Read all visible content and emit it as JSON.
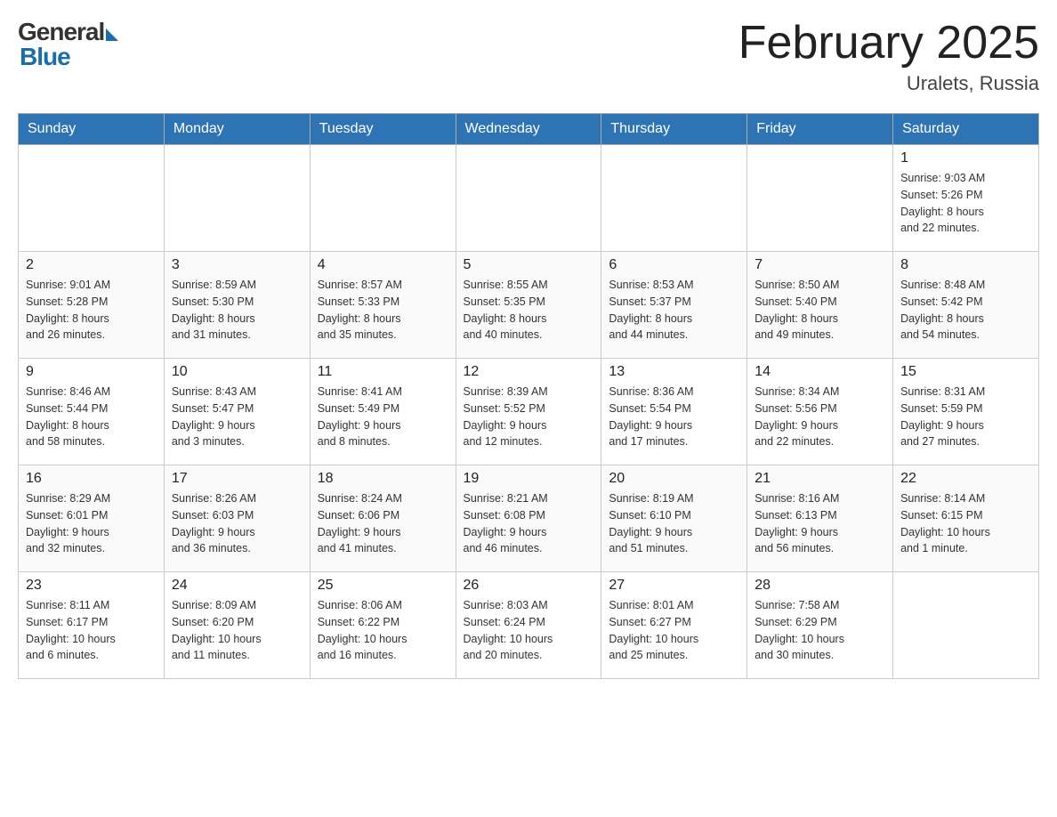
{
  "header": {
    "logo_general": "General",
    "logo_blue": "Blue",
    "month_title": "February 2025",
    "location": "Uralets, Russia"
  },
  "days_of_week": [
    "Sunday",
    "Monday",
    "Tuesday",
    "Wednesday",
    "Thursday",
    "Friday",
    "Saturday"
  ],
  "weeks": [
    [
      {
        "day": "",
        "info": ""
      },
      {
        "day": "",
        "info": ""
      },
      {
        "day": "",
        "info": ""
      },
      {
        "day": "",
        "info": ""
      },
      {
        "day": "",
        "info": ""
      },
      {
        "day": "",
        "info": ""
      },
      {
        "day": "1",
        "info": "Sunrise: 9:03 AM\nSunset: 5:26 PM\nDaylight: 8 hours\nand 22 minutes."
      }
    ],
    [
      {
        "day": "2",
        "info": "Sunrise: 9:01 AM\nSunset: 5:28 PM\nDaylight: 8 hours\nand 26 minutes."
      },
      {
        "day": "3",
        "info": "Sunrise: 8:59 AM\nSunset: 5:30 PM\nDaylight: 8 hours\nand 31 minutes."
      },
      {
        "day": "4",
        "info": "Sunrise: 8:57 AM\nSunset: 5:33 PM\nDaylight: 8 hours\nand 35 minutes."
      },
      {
        "day": "5",
        "info": "Sunrise: 8:55 AM\nSunset: 5:35 PM\nDaylight: 8 hours\nand 40 minutes."
      },
      {
        "day": "6",
        "info": "Sunrise: 8:53 AM\nSunset: 5:37 PM\nDaylight: 8 hours\nand 44 minutes."
      },
      {
        "day": "7",
        "info": "Sunrise: 8:50 AM\nSunset: 5:40 PM\nDaylight: 8 hours\nand 49 minutes."
      },
      {
        "day": "8",
        "info": "Sunrise: 8:48 AM\nSunset: 5:42 PM\nDaylight: 8 hours\nand 54 minutes."
      }
    ],
    [
      {
        "day": "9",
        "info": "Sunrise: 8:46 AM\nSunset: 5:44 PM\nDaylight: 8 hours\nand 58 minutes."
      },
      {
        "day": "10",
        "info": "Sunrise: 8:43 AM\nSunset: 5:47 PM\nDaylight: 9 hours\nand 3 minutes."
      },
      {
        "day": "11",
        "info": "Sunrise: 8:41 AM\nSunset: 5:49 PM\nDaylight: 9 hours\nand 8 minutes."
      },
      {
        "day": "12",
        "info": "Sunrise: 8:39 AM\nSunset: 5:52 PM\nDaylight: 9 hours\nand 12 minutes."
      },
      {
        "day": "13",
        "info": "Sunrise: 8:36 AM\nSunset: 5:54 PM\nDaylight: 9 hours\nand 17 minutes."
      },
      {
        "day": "14",
        "info": "Sunrise: 8:34 AM\nSunset: 5:56 PM\nDaylight: 9 hours\nand 22 minutes."
      },
      {
        "day": "15",
        "info": "Sunrise: 8:31 AM\nSunset: 5:59 PM\nDaylight: 9 hours\nand 27 minutes."
      }
    ],
    [
      {
        "day": "16",
        "info": "Sunrise: 8:29 AM\nSunset: 6:01 PM\nDaylight: 9 hours\nand 32 minutes."
      },
      {
        "day": "17",
        "info": "Sunrise: 8:26 AM\nSunset: 6:03 PM\nDaylight: 9 hours\nand 36 minutes."
      },
      {
        "day": "18",
        "info": "Sunrise: 8:24 AM\nSunset: 6:06 PM\nDaylight: 9 hours\nand 41 minutes."
      },
      {
        "day": "19",
        "info": "Sunrise: 8:21 AM\nSunset: 6:08 PM\nDaylight: 9 hours\nand 46 minutes."
      },
      {
        "day": "20",
        "info": "Sunrise: 8:19 AM\nSunset: 6:10 PM\nDaylight: 9 hours\nand 51 minutes."
      },
      {
        "day": "21",
        "info": "Sunrise: 8:16 AM\nSunset: 6:13 PM\nDaylight: 9 hours\nand 56 minutes."
      },
      {
        "day": "22",
        "info": "Sunrise: 8:14 AM\nSunset: 6:15 PM\nDaylight: 10 hours\nand 1 minute."
      }
    ],
    [
      {
        "day": "23",
        "info": "Sunrise: 8:11 AM\nSunset: 6:17 PM\nDaylight: 10 hours\nand 6 minutes."
      },
      {
        "day": "24",
        "info": "Sunrise: 8:09 AM\nSunset: 6:20 PM\nDaylight: 10 hours\nand 11 minutes."
      },
      {
        "day": "25",
        "info": "Sunrise: 8:06 AM\nSunset: 6:22 PM\nDaylight: 10 hours\nand 16 minutes."
      },
      {
        "day": "26",
        "info": "Sunrise: 8:03 AM\nSunset: 6:24 PM\nDaylight: 10 hours\nand 20 minutes."
      },
      {
        "day": "27",
        "info": "Sunrise: 8:01 AM\nSunset: 6:27 PM\nDaylight: 10 hours\nand 25 minutes."
      },
      {
        "day": "28",
        "info": "Sunrise: 7:58 AM\nSunset: 6:29 PM\nDaylight: 10 hours\nand 30 minutes."
      },
      {
        "day": "",
        "info": ""
      }
    ]
  ]
}
